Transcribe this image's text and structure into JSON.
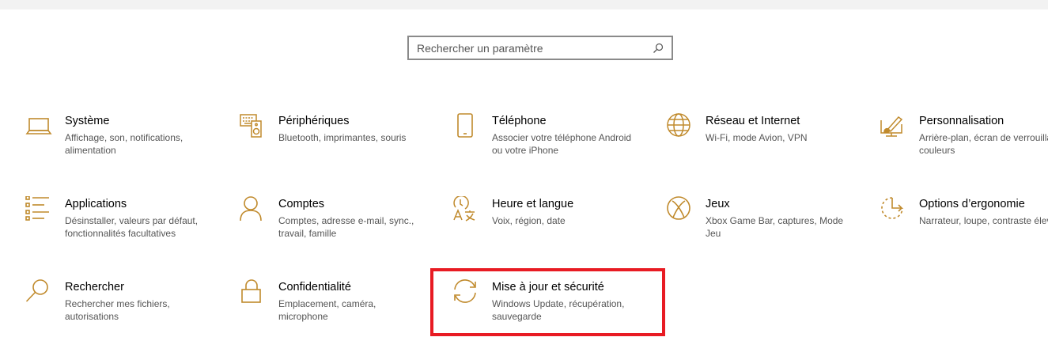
{
  "search": {
    "placeholder": "Rechercher un paramètre",
    "value": ""
  },
  "accent_color": "#c08a2c",
  "highlight_color": "#e81b23",
  "tiles": [
    {
      "icon": "laptop-icon",
      "title": "Système",
      "desc": "Affichage, son, notifications, alimentation"
    },
    {
      "icon": "keyboard-speaker-icon",
      "title": "Périphériques",
      "desc": "Bluetooth, imprimantes, souris"
    },
    {
      "icon": "phone-icon",
      "title": "Téléphone",
      "desc": "Associer votre téléphone Android ou votre iPhone"
    },
    {
      "icon": "globe-icon",
      "title": "Réseau et Internet",
      "desc": "Wi-Fi, mode Avion, VPN"
    },
    {
      "icon": "paint-brush-icon",
      "title": "Personnalisation",
      "desc": "Arrière-plan, écran de verrouillage, couleurs"
    },
    {
      "icon": "apps-list-icon",
      "title": "Applications",
      "desc": "Désinstaller, valeurs par défaut, fonctionnalités facultatives"
    },
    {
      "icon": "person-icon",
      "title": "Comptes",
      "desc": "Comptes, adresse e-mail, sync., travail, famille"
    },
    {
      "icon": "time-language-icon",
      "title": "Heure et langue",
      "desc": "Voix, région, date"
    },
    {
      "icon": "xbox-icon",
      "title": "Jeux",
      "desc": "Xbox Game Bar, captures, Mode Jeu"
    },
    {
      "icon": "ease-of-access-icon",
      "title": "Options d’ergonomie",
      "desc": "Narrateur, loupe, contraste élevé"
    },
    {
      "icon": "magnifier-icon",
      "title": "Rechercher",
      "desc": "Rechercher mes fichiers, autorisations"
    },
    {
      "icon": "lock-icon",
      "title": "Confidentialité",
      "desc": "Emplacement, caméra, microphone"
    },
    {
      "icon": "sync-icon",
      "title": "Mise à jour et sécurité",
      "desc": "Windows Update, récupération, sauvegarde"
    }
  ]
}
